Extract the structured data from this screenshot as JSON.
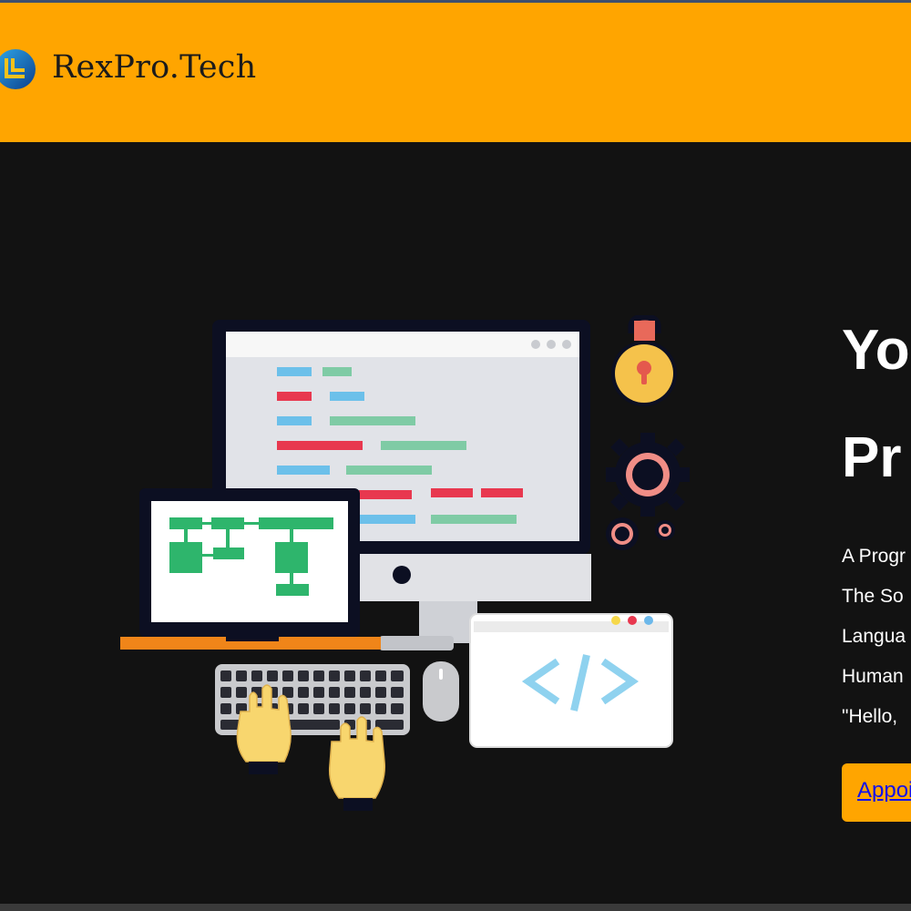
{
  "header": {
    "brand": "RexPro.Tech",
    "logo_icon": "rl-logo-icon",
    "background": "#ffa500"
  },
  "hero": {
    "background": "#121212",
    "illustration": "developer-workstation-illustration",
    "headline_lines": [
      "Yo",
      "Pr"
    ],
    "paragraph_lines": [
      "A Progr",
      "The So",
      "Langua",
      "Human",
      "\"Hello,"
    ],
    "cta_label": "Appoi"
  }
}
